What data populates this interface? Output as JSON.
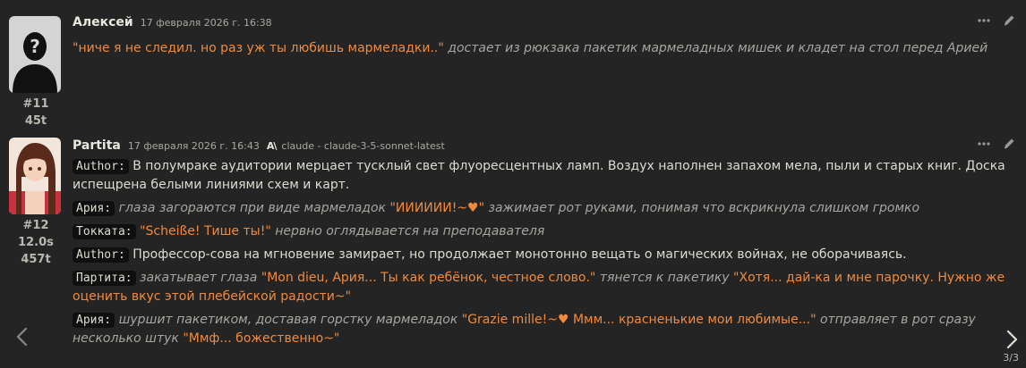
{
  "messages": [
    {
      "name": "Алексей",
      "time": "17 февраля 2026 г. 16:38",
      "index": "#11",
      "tokens": "45t",
      "segments": [
        {
          "kind": "quote",
          "text": "\"ниче я не следил. но раз уж ты любишь мармеладки..\""
        },
        {
          "kind": "ital",
          "text": " достает из рюкзака пакетик мармеладных мишек и кладет на стол перед Арией"
        }
      ]
    },
    {
      "name": "Partita",
      "time": "17 февраля 2026 г. 16:43",
      "model_icon_text": "A\\",
      "model": "claude - claude-3-5-sonnet-latest",
      "index": "#12",
      "gen_time": "12.0s",
      "tokens": "457t",
      "paragraphs": [
        {
          "speaker": "Author:",
          "segments": [
            {
              "kind": "plain",
              "text": " В полумраке аудитории мерцает тусклый свет флуоресцентных ламп. Воздух наполнен запахом мела, пыли и старых книг. Доска испещрена белыми линиями схем и карт."
            }
          ]
        },
        {
          "speaker": "Ария:",
          "segments": [
            {
              "kind": "ital",
              "text": " глаза загораются при виде мармеладок "
            },
            {
              "kind": "quote",
              "text": "\"ИИИИИИ!~♥\""
            },
            {
              "kind": "ital",
              "text": " зажимает рот руками, понимая что вскрикнула слишком громко"
            }
          ]
        },
        {
          "speaker": "Токката:",
          "segments": [
            {
              "kind": "quote",
              "text": " \"Scheiße! Тише ты!\""
            },
            {
              "kind": "ital",
              "text": " нервно оглядывается на преподавателя"
            }
          ]
        },
        {
          "speaker": "Author:",
          "segments": [
            {
              "kind": "plain",
              "text": " Профессор-сова на мгновение замирает, но продолжает монотонно вещать о магических войнах, не оборачиваясь."
            }
          ]
        },
        {
          "speaker": "Партита:",
          "segments": [
            {
              "kind": "ital",
              "text": " закатывает глаза "
            },
            {
              "kind": "quote",
              "text": "\"Mon dieu, Ария... Ты как ребёнок, честное слово.\""
            },
            {
              "kind": "ital",
              "text": " тянется к пакетику "
            },
            {
              "kind": "quote",
              "text": "\"Хотя... дай-ка и мне парочку. Нужно же оценить вкус этой плебейской радости~\""
            }
          ]
        },
        {
          "speaker": "Ария:",
          "segments": [
            {
              "kind": "ital",
              "text": " шуршит пакетиком, доставая горстку мармеладок "
            },
            {
              "kind": "quote",
              "text": "\"Grazie mille!~♥ Ммм... красненькие мои любимые...\""
            },
            {
              "kind": "ital",
              "text": " отправляет в рот сразу несколько штук "
            },
            {
              "kind": "quote",
              "text": "\"Ммф... божественно~\""
            }
          ]
        }
      ]
    }
  ],
  "swipe_counter": "3/3",
  "icons": {
    "more": "ellipsis-icon",
    "edit": "pencil-icon",
    "nav_left": "chevron-left-icon",
    "nav_right": "chevron-right-icon"
  },
  "colors": {
    "background": "#242424",
    "quote": "#f08a3c",
    "italic": "#a6a6a0",
    "text": "#dcdcd2",
    "speaker_bg": "#0f0f0f"
  }
}
